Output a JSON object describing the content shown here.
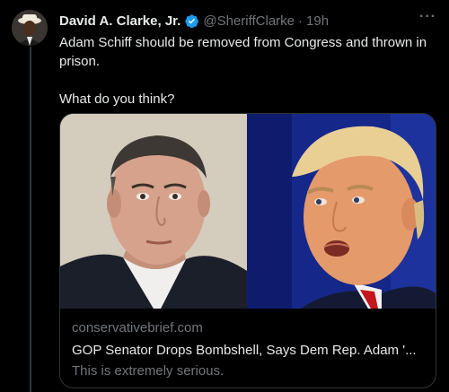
{
  "tweet": {
    "author_name": "David A. Clarke, Jr.",
    "handle": "@SheriffClarke",
    "separator": "·",
    "time": "19h",
    "more_label": "···",
    "text_line1": "Adam Schiff should be removed from Congress and thrown in prison.",
    "text_line2": "What do you think?"
  },
  "card": {
    "domain": "conservativebrief.com",
    "title": "GOP Senator Drops Bombshell, Says Dem Rep. Adam '...",
    "description": "This is extremely serious."
  },
  "colors": {
    "background": "#000000",
    "text_primary": "#e7e9ea",
    "text_secondary": "#71767b",
    "verified_blue": "#1d9bf0",
    "border": "#2f3336"
  },
  "icons": {
    "verified": "verified-badge-icon",
    "more": "more-horizontal-icon"
  }
}
